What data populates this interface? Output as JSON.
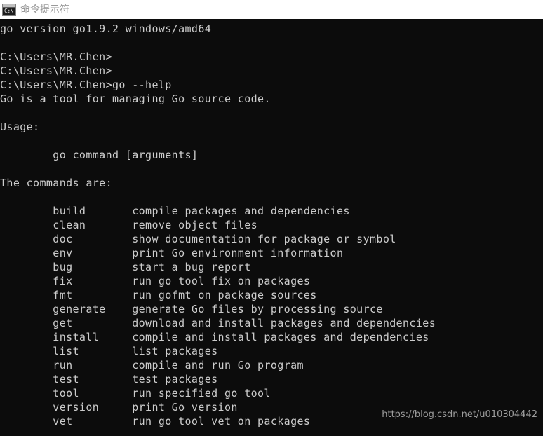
{
  "window": {
    "title": "命令提示符",
    "icon": "command-prompt-icon",
    "icon_glyph": "C:\\",
    "titlebar_bg": "#ffffff",
    "title_color": "#9a9a9a"
  },
  "console": {
    "background": "#0c0c0c",
    "foreground": "#cccccc",
    "lines": [
      "go version go1.9.2 windows/amd64",
      "",
      "C:\\Users\\MR.Chen>",
      "C:\\Users\\MR.Chen>",
      "C:\\Users\\MR.Chen>go --help",
      "Go is a tool for managing Go source code.",
      "",
      "Usage:",
      "",
      "        go command [arguments]",
      "",
      "The commands are:",
      "",
      "        build       compile packages and dependencies",
      "        clean       remove object files",
      "        doc         show documentation for package or symbol",
      "        env         print Go environment information",
      "        bug         start a bug report",
      "        fix         run go tool fix on packages",
      "        fmt         run gofmt on package sources",
      "        generate    generate Go files by processing source",
      "        get         download and install packages and dependencies",
      "        install     compile and install packages and dependencies",
      "        list        list packages",
      "        run         compile and run Go program",
      "        test        test packages",
      "        tool        run specified go tool",
      "        version     print Go version",
      "        vet         run go tool vet on packages"
    ],
    "commands": [
      {
        "name": "build",
        "description": "compile packages and dependencies"
      },
      {
        "name": "clean",
        "description": "remove object files"
      },
      {
        "name": "doc",
        "description": "show documentation for package or symbol"
      },
      {
        "name": "env",
        "description": "print Go environment information"
      },
      {
        "name": "bug",
        "description": "start a bug report"
      },
      {
        "name": "fix",
        "description": "run go tool fix on packages"
      },
      {
        "name": "fmt",
        "description": "run gofmt on package sources"
      },
      {
        "name": "generate",
        "description": "generate Go files by processing source"
      },
      {
        "name": "get",
        "description": "download and install packages and dependencies"
      },
      {
        "name": "install",
        "description": "compile and install packages and dependencies"
      },
      {
        "name": "list",
        "description": "list packages"
      },
      {
        "name": "run",
        "description": "compile and run Go program"
      },
      {
        "name": "test",
        "description": "test packages"
      },
      {
        "name": "tool",
        "description": "run specified go tool"
      },
      {
        "name": "version",
        "description": "print Go version"
      },
      {
        "name": "vet",
        "description": "run go tool vet on packages"
      }
    ],
    "go_version": "go version go1.9.2 windows/amd64",
    "prompt": "C:\\Users\\MR.Chen>",
    "command_entered": "go --help",
    "usage_heading": "Usage:",
    "usage_line": "go command [arguments]",
    "commands_heading": "The commands are:",
    "tool_description": "Go is a tool for managing Go source code."
  },
  "watermark": {
    "text": "https://blog.csdn.net/u010304442",
    "color": "#a9a9a9"
  }
}
